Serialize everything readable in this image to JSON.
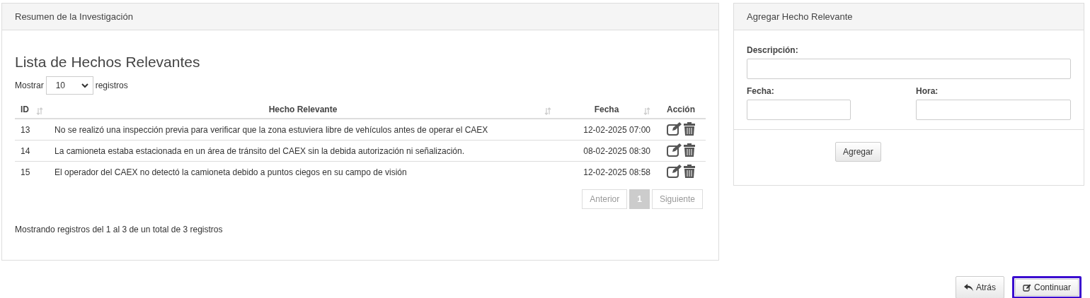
{
  "summary_panel": {
    "title": "Resumen de la Investigación",
    "list_title": "Lista de Hechos Relevantes",
    "length_menu": {
      "before": "Mostrar",
      "value": "10",
      "after": "registros"
    },
    "table": {
      "columns": [
        {
          "label": "ID",
          "sortable": true
        },
        {
          "label": "Hecho Relevante",
          "sortable": true
        },
        {
          "label": "Fecha",
          "sortable": true
        },
        {
          "label": "Acción",
          "sortable": false
        }
      ],
      "rows": [
        {
          "id": "13",
          "fact": "No se realizó una inspección previa para verificar que la zona estuviera libre de vehículos antes de operar el CAEX",
          "date": "12-02-2025 07:00"
        },
        {
          "id": "14",
          "fact": "La camioneta estaba estacionada en un área de tránsito del CAEX sin la debida autorización ni señalización.",
          "date": "08-02-2025 08:30"
        },
        {
          "id": "15",
          "fact": "El operador del CAEX no detectó la camioneta debido a puntos ciegos en su campo de visión",
          "date": "12-02-2025 08:58"
        }
      ]
    },
    "pagination": [
      {
        "label": "Anterior",
        "selected": false
      },
      {
        "label": "1",
        "selected": true
      },
      {
        "label": "Siguiente",
        "selected": false
      }
    ],
    "info": "Mostrando registros del 1 al 3 de un total de 3 registros"
  },
  "add_panel": {
    "title": "Agregar Hecho Relevante",
    "fields": [
      {
        "label": "Descripción:"
      },
      {
        "label": "Fecha:"
      },
      {
        "label": "Hora:"
      }
    ],
    "button": "Agregar"
  },
  "footer_buttons": [
    {
      "label": "Atrás",
      "focused": false
    },
    {
      "label": "Continuar",
      "focused": true
    }
  ]
}
